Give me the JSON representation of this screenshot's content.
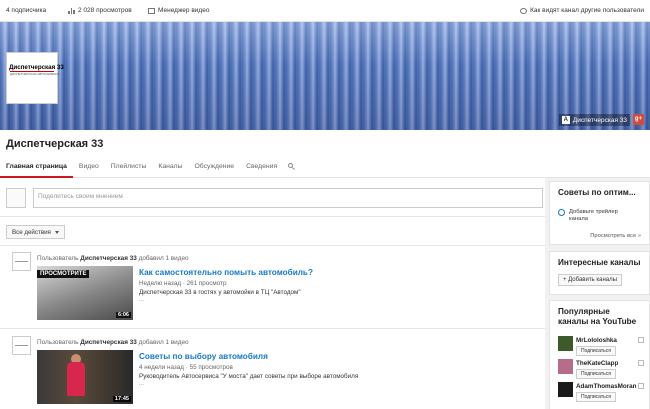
{
  "topbar": {
    "subscribers": "4 подписчика",
    "views": "2 028 просмотров",
    "video_manager": "Менеджер видео",
    "view_as": "Как видят канал другие пользователи"
  },
  "banner": {
    "avatar_text": "Диспетчерская 33",
    "avatar_subtext": "ДИСПЕТЧЕРСКАЯ АВТОСЕРВИСА",
    "link_label": "Диспетчерская 33",
    "gplus_label": "g+"
  },
  "channel": {
    "title": "Диспетчерская 33"
  },
  "tabs": [
    {
      "label": "Главная страница"
    },
    {
      "label": "Видео"
    },
    {
      "label": "Плейлисты"
    },
    {
      "label": "Каналы"
    },
    {
      "label": "Обсуждение"
    },
    {
      "label": "Сведения"
    }
  ],
  "comment": {
    "placeholder": "Поделитесь своим мнением"
  },
  "actions": {
    "label": "Все действия"
  },
  "feed": [
    {
      "prefix": "Пользователь",
      "author": "Диспетчерская 33",
      "action": "добавил 1 видео",
      "thumb_tag": "ПРОСМОТРИТЕ",
      "duration": "6:06",
      "title": "Как самостоятельно помыть автомобиль?",
      "meta": "Неделю назад · 261 просмотр",
      "desc": "Диспетчерская 33 в гостях у автомойки в ТЦ \"Автодом\"",
      "more": "..."
    },
    {
      "prefix": "Пользователь",
      "author": "Диспетчерская 33",
      "action": "добавил 1 видео",
      "thumb_tag": "",
      "duration": "17:45",
      "title": "Советы по выбору автомобиля",
      "meta": "4 недели назад · 55 просмотров",
      "desc": "Руководитель Автосервиса \"У моста\" дает советы при выборе автомобиля",
      "more": "..."
    }
  ],
  "sidebar": {
    "tips_title": "Советы по оптим...",
    "tip_text": "Добавьте трейлер канала",
    "see_all": "Просмотреть все »",
    "interesting_title": "Интересные каналы",
    "add_channels": "+ Добавить каналы",
    "popular_title_1": "Популярные",
    "popular_title_2": "каналы на YouTube",
    "popular": [
      {
        "name": "MrLololoshka",
        "subscribe": "Подписаться",
        "color": "#3d5a2a"
      },
      {
        "name": "TheKateClapp",
        "subscribe": "Подписаться",
        "color": "#b56d8a"
      },
      {
        "name": "AdamThomasMoran",
        "subscribe": "Подписаться",
        "color": "#1a1a1a"
      }
    ]
  },
  "colors": {
    "accent": "#cc181e",
    "link": "#167ac6"
  }
}
